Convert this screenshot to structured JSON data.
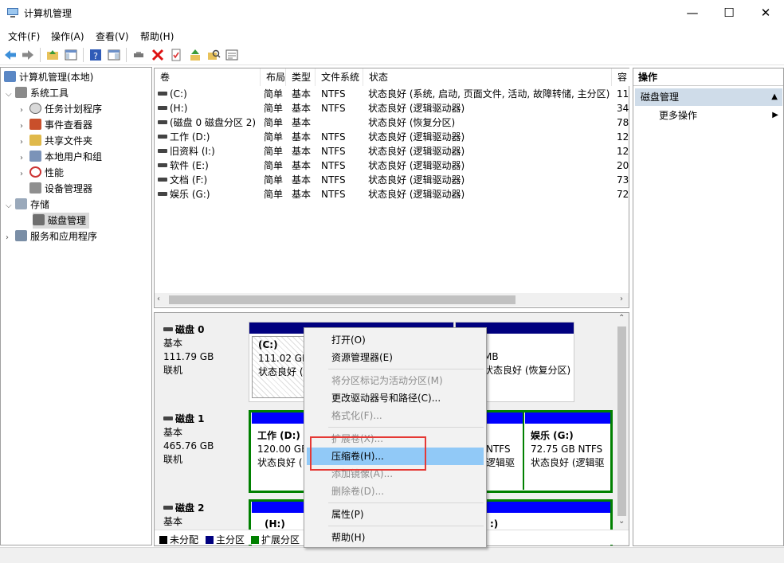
{
  "window": {
    "title": "计算机管理",
    "minimize": "—",
    "maximize": "☐",
    "close": "✕"
  },
  "menu": [
    "文件(F)",
    "操作(A)",
    "查看(V)",
    "帮助(H)"
  ],
  "tree": {
    "root": "计算机管理(本地)",
    "system_tools": "系统工具",
    "task_scheduler": "任务计划程序",
    "event_viewer": "事件查看器",
    "shared_folders": "共享文件夹",
    "local_users": "本地用户和组",
    "performance": "性能",
    "device_manager": "设备管理器",
    "storage": "存储",
    "disk_management": "磁盘管理",
    "services_apps": "服务和应用程序"
  },
  "volume_table": {
    "headers": [
      "卷",
      "布局",
      "类型",
      "文件系统",
      "状态",
      "容"
    ],
    "rows": [
      {
        "vol": "(C:)",
        "layout": "简单",
        "type": "基本",
        "fs": "NTFS",
        "status": "状态良好 (系统, 启动, 页面文件, 活动, 故障转储, 主分区)",
        "cap": "11"
      },
      {
        "vol": "(H:)",
        "layout": "简单",
        "type": "基本",
        "fs": "NTFS",
        "status": "状态良好 (逻辑驱动器)",
        "cap": "34"
      },
      {
        "vol": "(磁盘 0 磁盘分区 2)",
        "layout": "简单",
        "type": "基本",
        "fs": "",
        "status": "状态良好 (恢复分区)",
        "cap": "78"
      },
      {
        "vol": "工作 (D:)",
        "layout": "简单",
        "type": "基本",
        "fs": "NTFS",
        "status": "状态良好 (逻辑驱动器)",
        "cap": "12"
      },
      {
        "vol": "旧资料 (I:)",
        "layout": "简单",
        "type": "基本",
        "fs": "NTFS",
        "status": "状态良好 (逻辑驱动器)",
        "cap": "12"
      },
      {
        "vol": "软件 (E:)",
        "layout": "简单",
        "type": "基本",
        "fs": "NTFS",
        "status": "状态良好 (逻辑驱动器)",
        "cap": "20"
      },
      {
        "vol": "文档 (F:)",
        "layout": "简单",
        "type": "基本",
        "fs": "NTFS",
        "status": "状态良好 (逻辑驱动器)",
        "cap": "73"
      },
      {
        "vol": "娱乐 (G:)",
        "layout": "简单",
        "type": "基本",
        "fs": "NTFS",
        "status": "状态良好 (逻辑驱动器)",
        "cap": "72"
      }
    ]
  },
  "disks": {
    "disk0": {
      "name": "磁盘 0",
      "type": "基本",
      "size": "111.79 GB",
      "state": "联机"
    },
    "disk1": {
      "name": "磁盘 1",
      "type": "基本",
      "size": "465.76 GB",
      "state": "联机"
    },
    "disk2": {
      "name": "磁盘 2",
      "type": "基本"
    },
    "c_part": {
      "name": "(C:)",
      "size": "111.02 GB",
      "status": "状态良好 (系"
    },
    "recovery_part": {
      "size": "MB",
      "status": "状态良好 (恢复分区)"
    },
    "d_part": {
      "name": "工作 (D:)",
      "size": "120.00 GB",
      "status": "状态良好 ("
    },
    "f_part": {
      "size": "NTFS",
      "status": "逻辑驱"
    },
    "g_part": {
      "name": "娱乐 (G:)",
      "size": "72.75 GB NTFS",
      "status": "状态良好 (逻辑驱"
    },
    "h_part": {
      "name": "(H:)"
    },
    "disk2_right": ":)"
  },
  "legend": [
    "未分配",
    "主分区",
    "扩展分区"
  ],
  "actions": {
    "header": "操作",
    "section": "磁盘管理",
    "more": "更多操作"
  },
  "context_menu": {
    "open": "打开(O)",
    "explorer": "资源管理器(E)",
    "mark_active": "将分区标记为活动分区(M)",
    "change_letter": "更改驱动器号和路径(C)...",
    "format": "格式化(F)...",
    "extend": "扩展卷(X)...",
    "shrink": "压缩卷(H)...",
    "add_mirror": "添加镜像(A)...",
    "delete": "删除卷(D)...",
    "properties": "属性(P)",
    "help": "帮助(H)"
  },
  "colors": {
    "primary_partition": "#00007f",
    "logical_drive": "#0000ff",
    "extended_partition": "#008000",
    "selection": "#91c9f7",
    "annotation": "#e53935"
  }
}
